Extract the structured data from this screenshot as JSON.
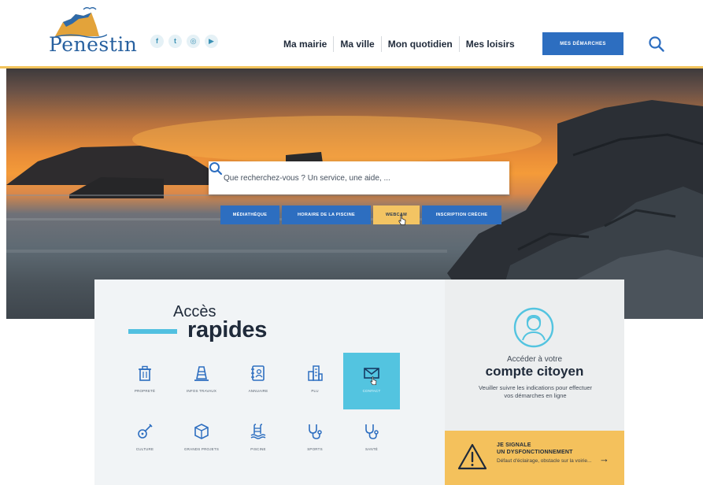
{
  "header": {
    "logo_text": "Penestin",
    "socials": [
      {
        "icon": "facebook-icon",
        "glyph": "f"
      },
      {
        "icon": "twitter-icon",
        "glyph": "t"
      },
      {
        "icon": "instagram-icon",
        "glyph": "◎"
      },
      {
        "icon": "youtube-icon",
        "glyph": "▶"
      }
    ],
    "nav": [
      "Ma mairie",
      "Ma ville",
      "Mon quotidien",
      "Mes loisirs"
    ],
    "cta": "MES DÉMARCHES",
    "search_icon": "search-icon"
  },
  "hero": {
    "search_placeholder": "Que recherchez-vous ? Un service, une aide, ...",
    "quick_links": [
      {
        "label": "MÉDIATHÈQUE",
        "active": false
      },
      {
        "label": "HORAIRE DE LA PISCINE",
        "active": false
      },
      {
        "label": "WEBCAM",
        "active": true
      },
      {
        "label": "INSCRIPTION CRÈCHE",
        "active": false
      }
    ]
  },
  "acces": {
    "title_line1": "Accès",
    "title_line2": "rapides",
    "tiles": [
      {
        "label": "PROPRETÉ",
        "icon": "trash-icon",
        "active": false
      },
      {
        "label": "INFOS TRAVAUX",
        "icon": "cone-icon",
        "active": false
      },
      {
        "label": "ANNUAIRE",
        "icon": "book-icon",
        "active": false
      },
      {
        "label": "PLU",
        "icon": "building-icon",
        "active": false
      },
      {
        "label": "CONTACT",
        "icon": "envelope-icon",
        "active": true
      },
      {
        "label": "CULTURE",
        "icon": "guitar-icon",
        "active": false
      },
      {
        "label": "GRANDS PROJETS",
        "icon": "box-icon",
        "active": false
      },
      {
        "label": "PISCINE",
        "icon": "pool-icon",
        "active": false
      },
      {
        "label": "SPORTS",
        "icon": "stethoscope-icon",
        "active": false
      },
      {
        "label": "SANTÉ",
        "icon": "stethoscope-icon",
        "active": false
      }
    ]
  },
  "citoyen": {
    "line1": "Accéder à votre",
    "line2": "compte citoyen",
    "desc": "Veuiller suivre les indications pour effectuer vos démarches en ligne"
  },
  "signal": {
    "title1": "JE SIGNALE",
    "title2": "UN DYSFONCTIONNEMENT",
    "desc": "Défaut d'éclairage, obstacle sur la voirie...",
    "arrow": "→"
  },
  "colors": {
    "brand_blue": "#2d6ec0",
    "accent_cyan": "#53c4e0",
    "accent_gold": "#f3c463",
    "text_dark": "#1f2a3a"
  }
}
